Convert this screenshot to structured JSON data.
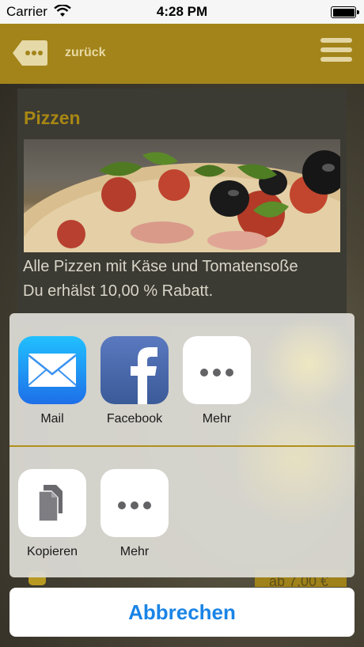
{
  "status_bar": {
    "carrier": "Carrier",
    "time": "4:28 PM",
    "wifi_icon": "wifi-icon",
    "battery_icon": "battery-icon"
  },
  "nav": {
    "back_icon": "back-bubble-icon",
    "back_label": "zurück",
    "menu_icon": "hamburger-menu-icon"
  },
  "card": {
    "title": "Pizzen",
    "image": "pizza-photo",
    "desc_line1": "Alle Pizzen mit Käse und Tomatensoße",
    "desc_line2": "Du erhälst 10,00 % Rabatt.",
    "price_partial": "ab 7,00 €"
  },
  "share_sheet": {
    "row1": [
      {
        "label": "Mail",
        "icon": "mail-icon"
      },
      {
        "label": "Facebook",
        "icon": "facebook-icon"
      },
      {
        "label": "Mehr",
        "icon": "more-icon"
      }
    ],
    "row2": [
      {
        "label": "Kopieren",
        "icon": "copy-icon"
      },
      {
        "label": "Mehr",
        "icon": "more-icon"
      }
    ],
    "cancel_label": "Abbrechen"
  },
  "colors": {
    "nav_gold": "#a2841a",
    "title_gold": "#a88713",
    "cancel_blue": "#1a84e6"
  }
}
